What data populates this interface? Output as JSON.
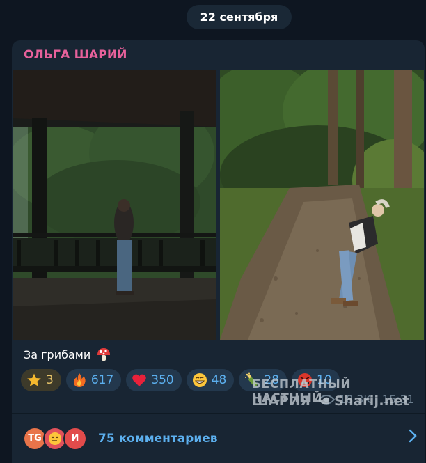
{
  "date_separator": "22 сентября",
  "post": {
    "author": "ОЛЬГА ШАРИЙ",
    "caption": "За грибами",
    "caption_emoji": "mushroom",
    "reactions": [
      {
        "icon": "star-emoji",
        "count": "3"
      },
      {
        "icon": "fire-emoji",
        "count": "617"
      },
      {
        "icon": "heart-emoji",
        "count": "350"
      },
      {
        "icon": "grin-emoji",
        "count": "48"
      },
      {
        "icon": "champagne-emoji",
        "count": "28"
      },
      {
        "icon": "angry-face-emoji",
        "count": "10"
      }
    ],
    "views": "18.3K",
    "time": "15:31"
  },
  "comments": {
    "avatars": [
      {
        "label": "TG",
        "color": "#e8744a"
      },
      {
        "label": "",
        "color": "#e0525b"
      },
      {
        "label": "И",
        "color": "#e14b4b"
      }
    ],
    "label": "75 комментариев"
  },
  "watermark": {
    "line1": "БЕСПЛАТНЫЙ ЧАСТНЫЙ",
    "line2_left": "ШАРИЯ",
    "line2_right": "Sharij.net"
  },
  "colors": {
    "background": "#0e1621",
    "card": "#182533",
    "author": "#e7619b",
    "link": "#5cb0ef",
    "meta": "#6d7f8f"
  }
}
